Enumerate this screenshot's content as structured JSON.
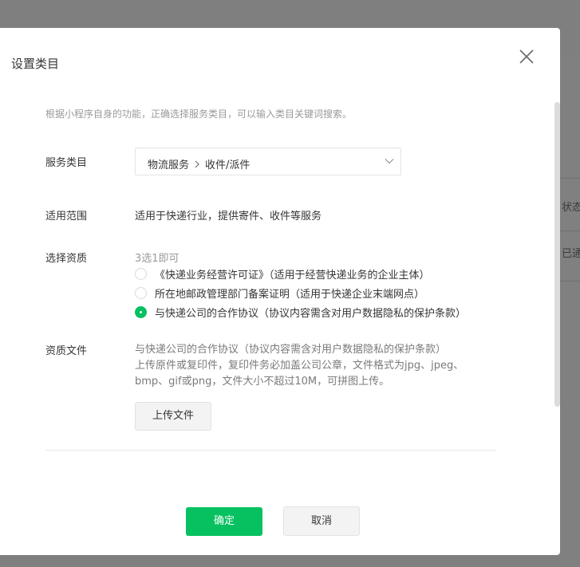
{
  "background": {
    "status_label": "状态",
    "status_value": "已通"
  },
  "dialog": {
    "title": "设置类目",
    "hint": "根据小程序自身的功能，正确选择服务类目，可以输入类目关键词搜索。",
    "service_category": {
      "label": "服务类目",
      "level1": "物流服务",
      "level2": "收件/派件"
    },
    "scope": {
      "label": "适用范围",
      "value": "适用于快递行业，提供寄件、收件等服务"
    },
    "qualification": {
      "label": "选择资质",
      "hint": "3选1即可",
      "options": [
        {
          "label": "《快递业务经营许可证》（适用于经营快递业务的企业主体）",
          "checked": false
        },
        {
          "label": "所在地邮政管理部门备案证明（适用于快递企业末端网点）",
          "checked": false
        },
        {
          "label": "与快递公司的合作协议（协议内容需含对用户数据隐私的保护条款）",
          "checked": true
        }
      ]
    },
    "files": {
      "label": "资质文件",
      "line1": "与快递公司的合作协议（协议内容需含对用户数据隐私的保护条款）",
      "line2": "上传原件或复印件，复印件务必加盖公司公章，文件格式为jpg、jpeg、",
      "line3": "bmp、gif或png，文件大小不超过10M，可拼图上传。",
      "upload_label": "上传文件"
    },
    "confirm_label": "确定",
    "cancel_label": "取消"
  },
  "colors": {
    "accent": "#07c160",
    "overlay": "#7f7f7f"
  }
}
